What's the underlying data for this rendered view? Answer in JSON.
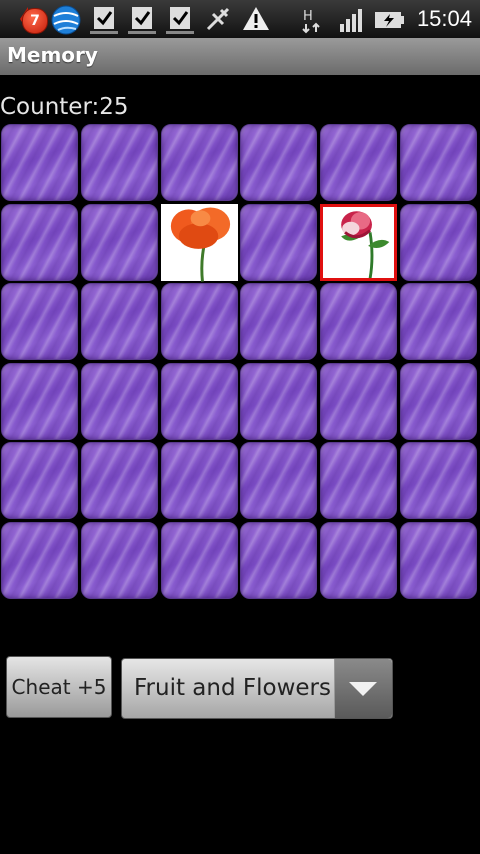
{
  "status_bar": {
    "notification_count": "7",
    "time": "15:04",
    "network_type": "H",
    "icons": [
      "notification-badge-icon",
      "sync-globe-icon",
      "download-done-icon",
      "download-done-icon",
      "download-done-icon",
      "usb-debug-icon",
      "warning-icon",
      "network-h-icon",
      "signal-icon",
      "battery-charging-icon"
    ]
  },
  "app": {
    "title": "Memory"
  },
  "game": {
    "counter_label": "Counter:25",
    "grid_rows": 6,
    "grid_cols": 6,
    "revealed_tiles": [
      {
        "row": 2,
        "col": 3,
        "image": "poppy-flower",
        "selected": false
      },
      {
        "row": 2,
        "col": 5,
        "image": "rose-flower",
        "selected": true
      }
    ]
  },
  "controls": {
    "cheat_label": "Cheat +5",
    "category_selected": "Fruit and Flowers"
  },
  "colors": {
    "tile_back": "#8a5ccf",
    "selected_outline": "#e01010",
    "poppy": "#f05a1e",
    "rose": "#c8234a"
  }
}
